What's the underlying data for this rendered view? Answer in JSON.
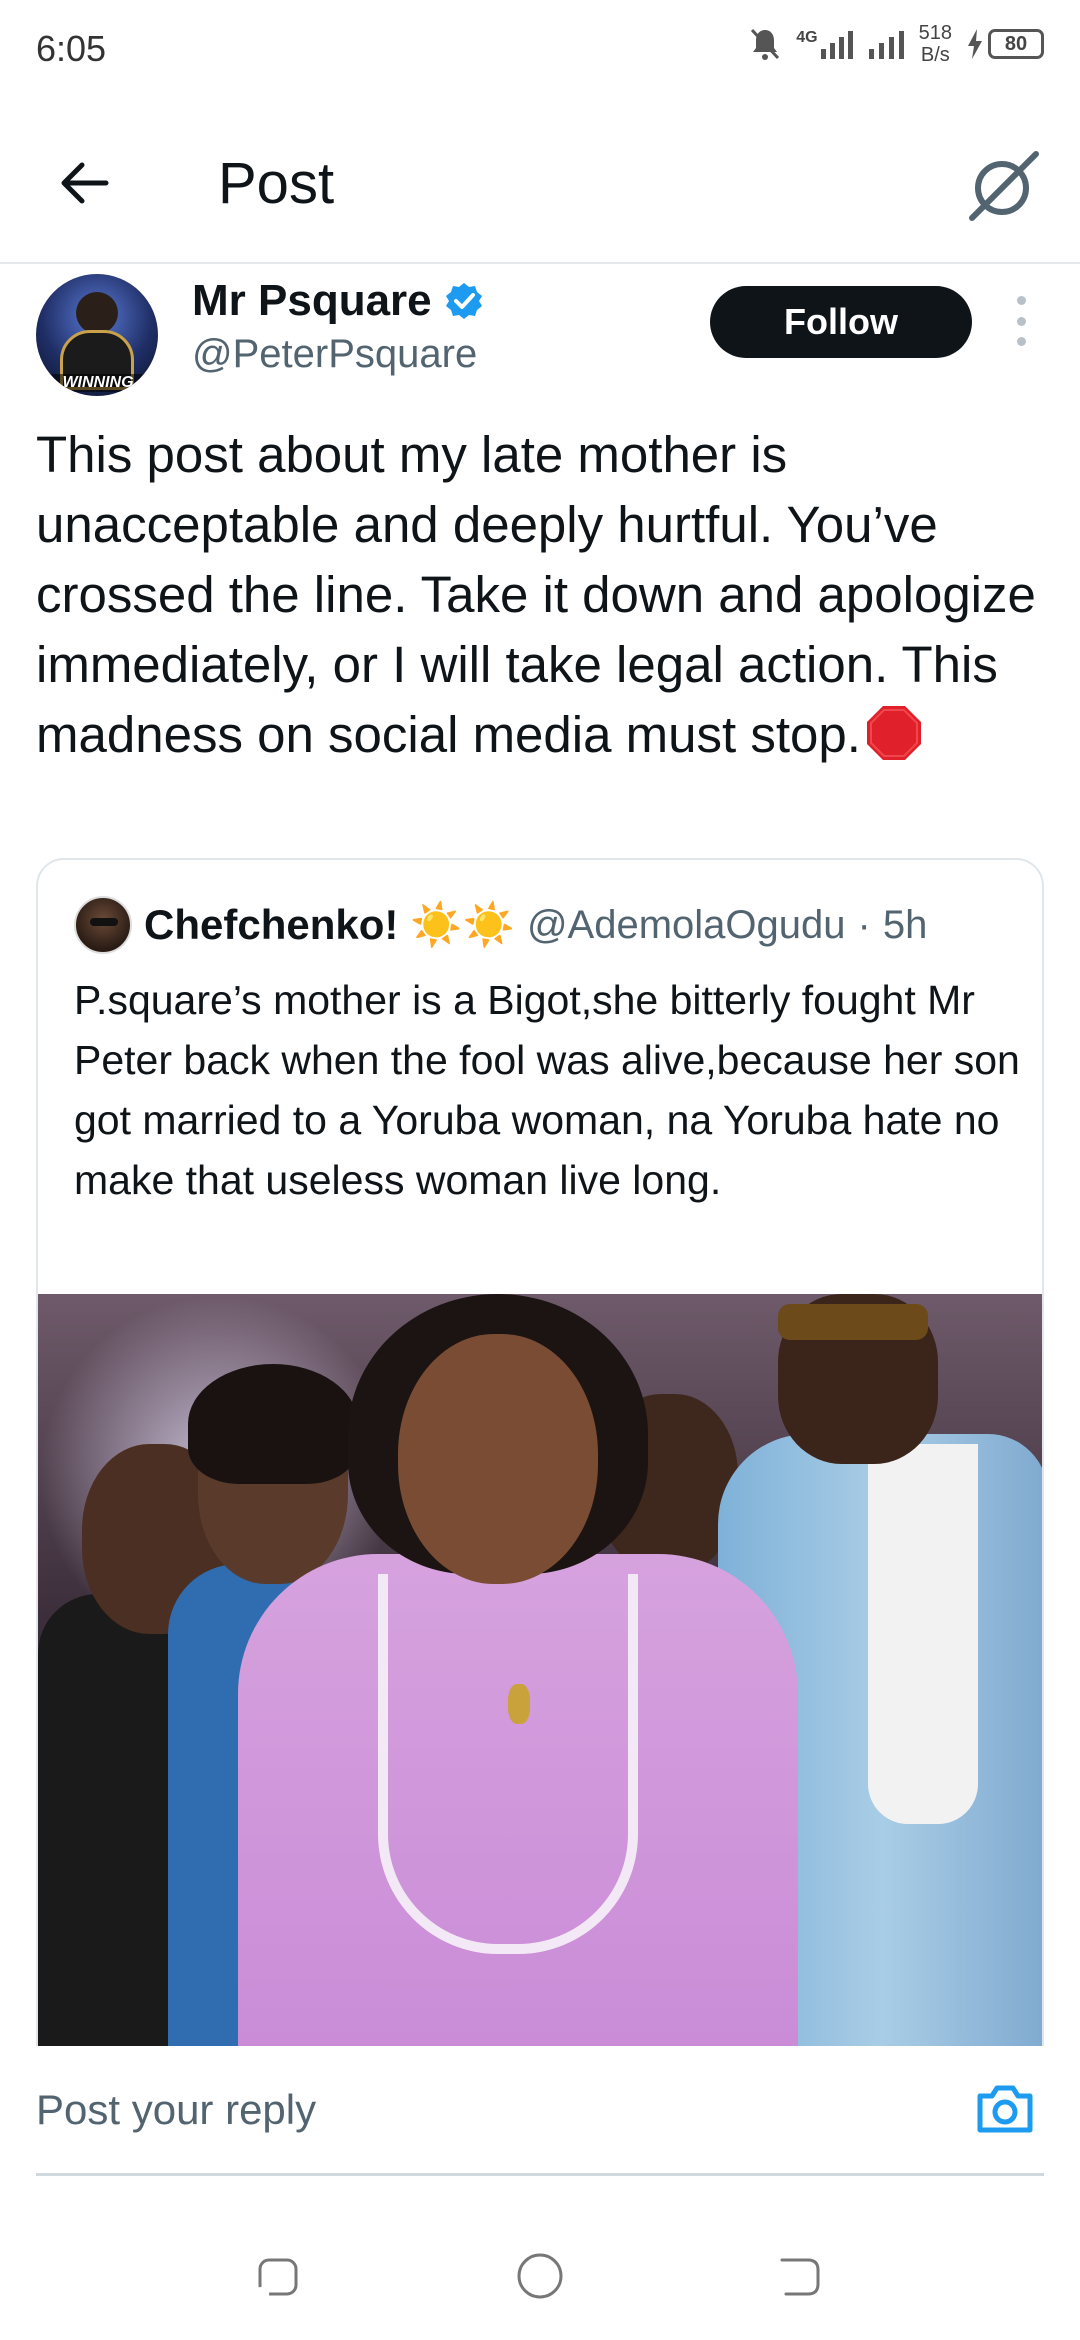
{
  "status_bar": {
    "time": "6:05",
    "network_type": "4G",
    "net_speed_value": "518",
    "net_speed_unit": "B/s",
    "battery": "80"
  },
  "header": {
    "title": "Post",
    "back_icon": "arrow-left-icon",
    "grok_icon": "grok-icon"
  },
  "post": {
    "author_name": "Mr Psquare",
    "author_handle": "@PeterPsquare",
    "avatar_caption": "WINNING",
    "follow_label": "Follow",
    "text": "This post about my late mother is unacceptable and deeply hurtful. You’ve crossed the line. Take it down and apologize immediately, or I will take legal action. This madness on social media must stop.",
    "trailing_emoji": "stop-sign-icon"
  },
  "quoted_post": {
    "author_name": "Chefchenko!",
    "emoji": "☀️☀️",
    "author_handle": "@AdemolaOgudu",
    "separator": "·",
    "time": "5h",
    "text": "P.square’s mother is a Bigot,she bitterly fought Mr Peter back when the fool was alive,because her son got married to a Yoruba woman, na Yoruba hate no make that useless woman live long."
  },
  "reply": {
    "placeholder": "Post your reply",
    "camera_icon": "camera-icon"
  },
  "colors": {
    "accent": "#1d9bf0",
    "text_primary": "#0f1419",
    "text_secondary": "#536471",
    "follow_bg": "#0f1419"
  }
}
